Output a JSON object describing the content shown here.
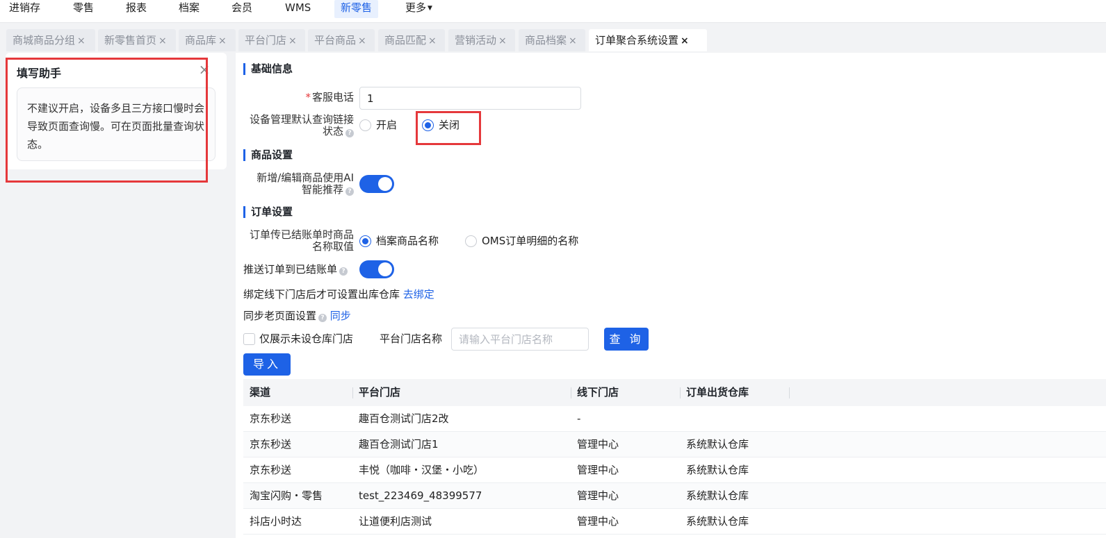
{
  "topnav": {
    "items": [
      {
        "label": "进销存"
      },
      {
        "label": "零售"
      },
      {
        "label": "报表"
      },
      {
        "label": "档案"
      },
      {
        "label": "会员"
      },
      {
        "label": "WMS"
      },
      {
        "label": "新零售"
      },
      {
        "label": "更多"
      }
    ],
    "active": "新零售"
  },
  "tabs": [
    {
      "label": "商城商品分组"
    },
    {
      "label": "新零售首页"
    },
    {
      "label": "商品库"
    },
    {
      "label": "平台门店"
    },
    {
      "label": "平台商品"
    },
    {
      "label": "商品匹配"
    },
    {
      "label": "营销活动"
    },
    {
      "label": "商品档案"
    },
    {
      "label": "订单聚合系统设置"
    }
  ],
  "tab_close_glyph": "×",
  "helper": {
    "title": "填写助手",
    "close_glyph": "×",
    "text": "不建议开启，设备多且三方接口慢时会导致页面查询慢。可在页面批量查询状态。"
  },
  "sections": {
    "basic": "基础信息",
    "product": "商品设置",
    "order": "订单设置"
  },
  "form": {
    "service_phone": {
      "label": "客服电话",
      "required_mark": "*",
      "value": "1"
    },
    "device_query": {
      "label_line1": "设备管理默认查询链接",
      "label_line2": "状态",
      "options": [
        "开启",
        "关闭"
      ],
      "selected": "关闭"
    },
    "ai_recommend": {
      "label_line1": "新增/编辑商品使用AI",
      "label_line2": "智能推荐",
      "on": true
    },
    "order_name": {
      "label_line1": "订单传已结账单时商品",
      "label_line2": "名称取值",
      "options": [
        "档案商品名称",
        "OMS订单明细的名称"
      ],
      "selected": "档案商品名称"
    },
    "push_order": {
      "label": "推送订单到已结账单",
      "on": true
    },
    "bind_text": "绑定线下门店后才可设置出库仓库",
    "bind_link": "去绑定",
    "sync_text": "同步老页面设置",
    "sync_link": "同步",
    "only_unset_label": "仅展示未设仓库门店",
    "store_name_label": "平台门店名称",
    "store_name_placeholder": "请输入平台门店名称",
    "query_button": "查 询",
    "import_button": "导入"
  },
  "table": {
    "columns": [
      "渠道",
      "平台门店",
      "线下门店",
      "订单出货仓库"
    ],
    "rows": [
      [
        "京东秒送",
        "趣百仓测试门店2改",
        "-",
        ""
      ],
      [
        "京东秒送",
        "趣百仓测试门店1",
        "管理中心",
        "系统默认仓库"
      ],
      [
        "京东秒送",
        "丰悦（咖啡・汉堡・小吃）",
        "管理中心",
        "系统默认仓库"
      ],
      [
        "淘宝闪购・零售",
        "test_223469_48399577",
        "管理中心",
        "系统默认仓库"
      ],
      [
        "抖店小时达",
        "让道便利店测试",
        "管理中心",
        "系统默认仓库"
      ]
    ]
  },
  "colors": {
    "accent": "#1e62e6",
    "highlight_box": "#e5383b"
  }
}
